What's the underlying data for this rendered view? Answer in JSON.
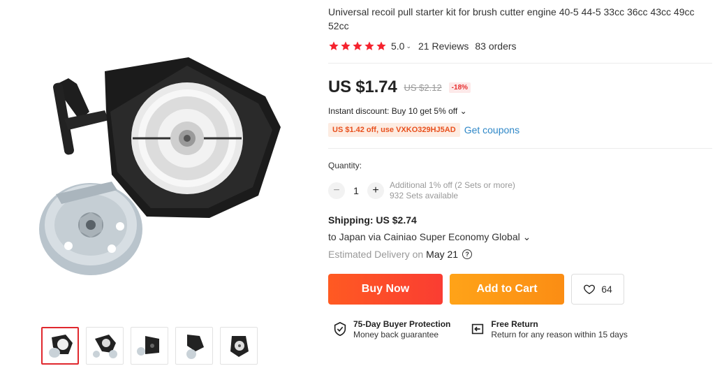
{
  "product": {
    "title": "Universal recoil pull starter kit for brush cutter engine 40-5 44-5 33cc 36cc 43cc 49cc 52cc",
    "rating": "5.0",
    "rating_chevron": "⌄",
    "reviews": "21 Reviews",
    "orders": "83 orders",
    "stars": 5
  },
  "price": {
    "current": "US $1.74",
    "original": "US $2.12",
    "discount": "-18%"
  },
  "promo": {
    "instant_discount": "Instant discount: Buy 10 get 5% off ⌄",
    "coupon": "US $1.42 off, use VXKO329HJ5AD",
    "get_coupons": "Get coupons"
  },
  "quantity": {
    "label": "Quantity:",
    "value": "1",
    "minus": "−",
    "plus": "+",
    "additional": "Additional 1% off (2 Sets or more)",
    "available": "932 Sets available"
  },
  "shipping": {
    "title": "Shipping: US $2.74",
    "route": "to Japan via Cainiao Super Economy Global ⌄",
    "estimated_label": "Estimated Delivery on",
    "estimated_date": "May 21",
    "help": "?"
  },
  "actions": {
    "buy_now": "Buy Now",
    "add_to_cart": "Add to Cart",
    "wishlist_count": "64"
  },
  "guarantees": [
    {
      "title": "75-Day Buyer Protection",
      "subtitle": "Money back guarantee",
      "icon": "shield-check-icon"
    },
    {
      "title": "Free Return",
      "subtitle": "Return for any reason within 15 days",
      "icon": "return-icon"
    }
  ],
  "gallery": {
    "thumbnail_count": 5,
    "active_index": 0
  },
  "colors": {
    "star": "#f5222d",
    "buy_now": "#fa4a28",
    "add_to_cart": "#fc9616",
    "discount_badge": "#e62e2e",
    "coupon_text": "#e8501d",
    "link": "#2e87c7",
    "active_thumb_border": "#e0282e"
  }
}
